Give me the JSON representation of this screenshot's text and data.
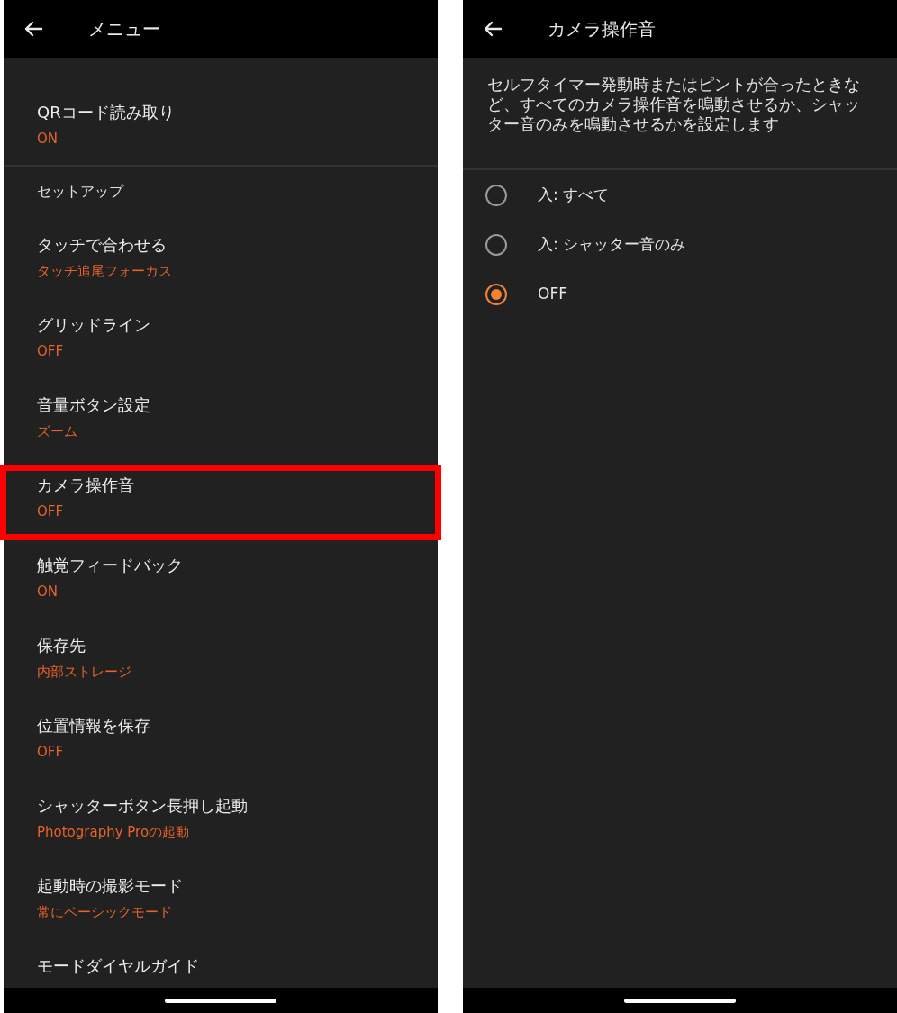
{
  "menu_screen": {
    "title": "メニュー",
    "items": [
      {
        "kind": "setting",
        "label": "QRコード読み取り",
        "value": "ON",
        "highlighted": false
      },
      {
        "kind": "section",
        "label": "セットアップ"
      },
      {
        "kind": "setting",
        "label": "タッチで合わせる",
        "value": "タッチ追尾フォーカス",
        "highlighted": false
      },
      {
        "kind": "setting",
        "label": "グリッドライン",
        "value": "OFF",
        "highlighted": false
      },
      {
        "kind": "setting",
        "label": "音量ボタン設定",
        "value": "ズーム",
        "highlighted": false
      },
      {
        "kind": "setting",
        "label": "カメラ操作音",
        "value": "OFF",
        "highlighted": true
      },
      {
        "kind": "setting",
        "label": "触覚フィードバック",
        "value": "ON",
        "highlighted": false
      },
      {
        "kind": "setting",
        "label": "保存先",
        "value": "内部ストレージ",
        "highlighted": false
      },
      {
        "kind": "setting",
        "label": "位置情報を保存",
        "value": "OFF",
        "highlighted": false
      },
      {
        "kind": "setting",
        "label": "シャッターボタン長押し起動",
        "value": "Photography Proの起動",
        "highlighted": false
      },
      {
        "kind": "setting",
        "label": "起動時の撮影モード",
        "value": "常にベーシックモード",
        "highlighted": false
      },
      {
        "kind": "setting",
        "label": "モードダイヤルガイド",
        "highlighted": false
      }
    ]
  },
  "detail_screen": {
    "title": "カメラ操作音",
    "description": "セルフタイマー発動時またはピントが合ったときなど、すべてのカメラ操作音を鳴動させるか、シャッター音のみを鳴動させるかを設定します",
    "options": [
      {
        "label": "入: すべて",
        "selected": false
      },
      {
        "label": "入: シャッター音のみ",
        "selected": false
      },
      {
        "label": "OFF",
        "selected": true
      }
    ]
  }
}
